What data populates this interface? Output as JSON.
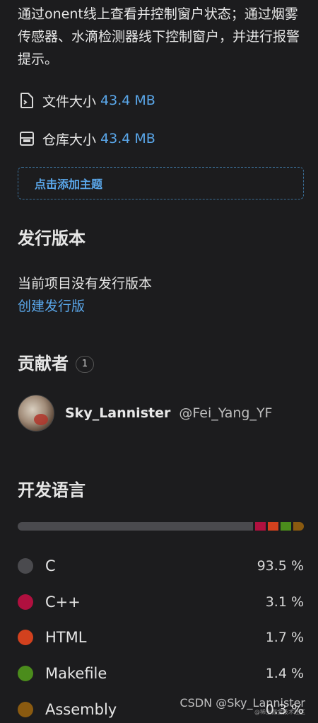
{
  "repo": {
    "description": "通过onent线上查看并控制窗户状态；通过烟雾传感器、水滴检测器线下控制窗户，并进行报警提示。",
    "file_size_label": "文件大小",
    "file_size_value": "43.4 MB",
    "repo_size_label": "仓库大小",
    "repo_size_value": "43.4 MB",
    "add_topic": "点击添加主题"
  },
  "releases": {
    "title": "发行版本",
    "empty_text": "当前项目没有发行版本",
    "create_link": "创建发行版"
  },
  "contributors": {
    "title": "贡献者",
    "count": "1",
    "items": [
      {
        "name": "Sky_Lannister",
        "handle": "@Fei_Yang_YF"
      }
    ]
  },
  "languages": {
    "title": "开发语言",
    "items": [
      {
        "name": "C",
        "percent": "93.5 %",
        "share": 93.5,
        "color": "#4a4a4e"
      },
      {
        "name": "C++",
        "percent": "3.1 %",
        "share": 3.1,
        "color": "#b0103f"
      },
      {
        "name": "HTML",
        "percent": "1.7 %",
        "share": 1.7,
        "color": "#d2411e"
      },
      {
        "name": "Makefile",
        "percent": "1.4 %",
        "share": 1.4,
        "color": "#4b8c1c"
      },
      {
        "name": "Assembly",
        "percent": "0.3 %",
        "share": 0.3,
        "color": "#8a5a10"
      }
    ]
  },
  "watermark": {
    "text": "CSDN @Sky_Lannister",
    "small": "@稀土掘金技术社区"
  },
  "icons": {
    "file": "file-code-icon",
    "repo": "database-icon"
  }
}
